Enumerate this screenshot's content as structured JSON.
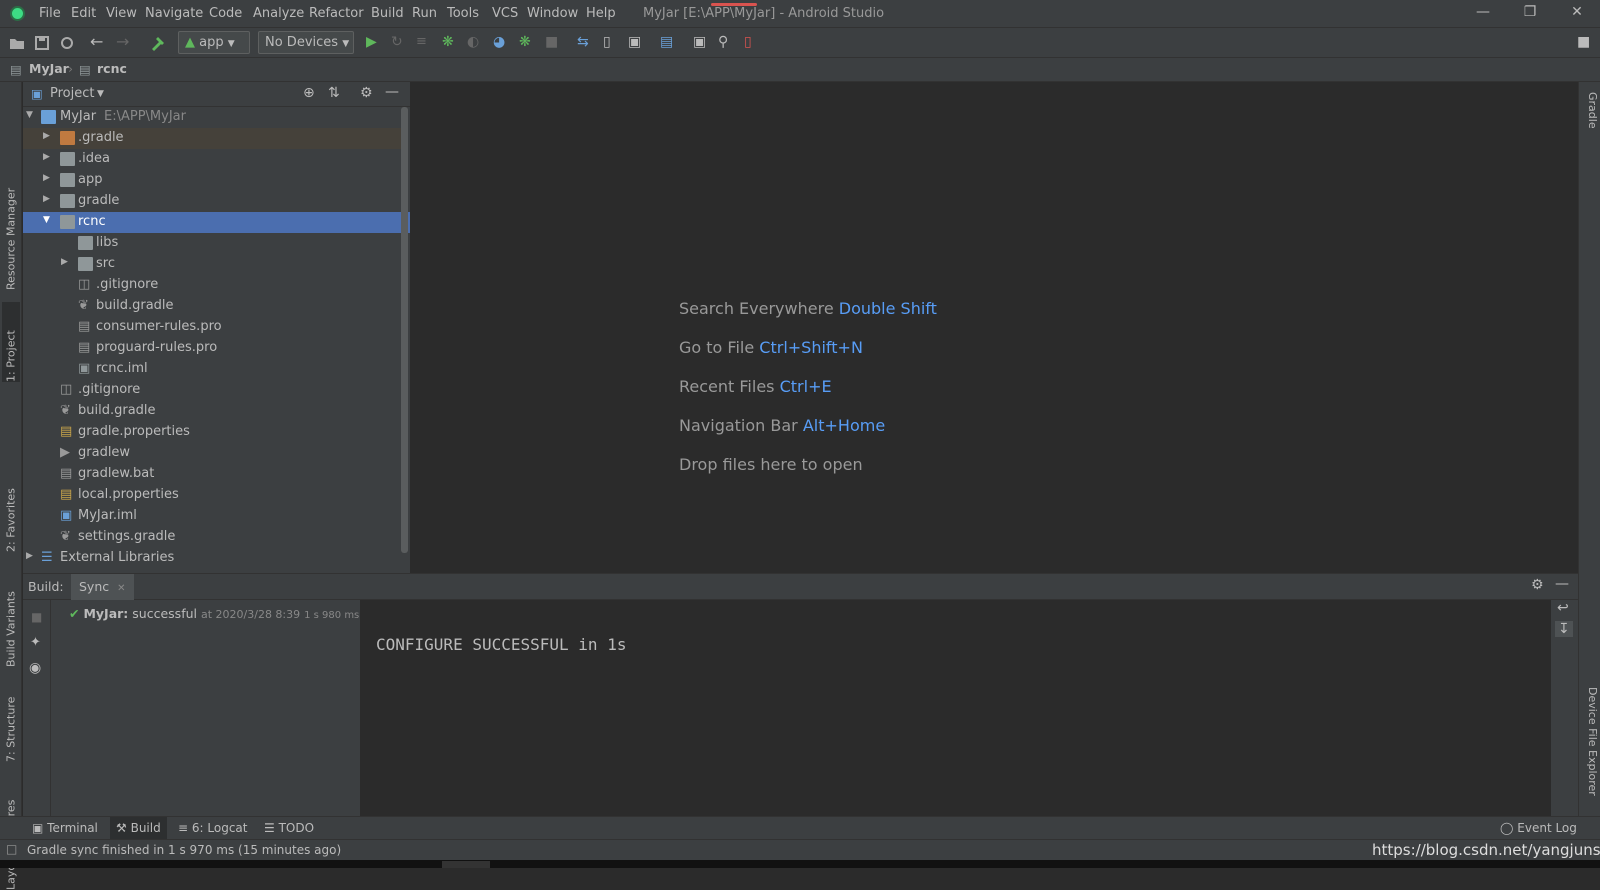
{
  "app": {
    "title": "MyJar [E:\\APP\\MyJar] - Android Studio",
    "accent": "#589df6"
  },
  "menu": [
    "File",
    "Edit",
    "View",
    "Navigate",
    "Code",
    "Analyze",
    "Refactor",
    "Build",
    "Run",
    "Tools",
    "VCS",
    "Window",
    "Help"
  ],
  "toolbar": {
    "run_config": "app",
    "device": "No Devices"
  },
  "breadcrumb": {
    "project": "MyJar",
    "module": "rcnc"
  },
  "left_tabs": {
    "resource_manager": "Resource Manager",
    "project": "1: Project",
    "favorites": "2: Favorites",
    "build_variants": "Build Variants",
    "structure": "7: Structure",
    "layout_captures": "Layout Captures"
  },
  "right_tabs": {
    "gradle": "Gradle",
    "device_file_explorer": "Device File Explorer"
  },
  "project_panel": {
    "view_label": "Project",
    "root": {
      "name": "MyJar",
      "path": "E:\\APP\\MyJar"
    },
    "items": [
      {
        "label": ".gradle"
      },
      {
        "label": ".idea"
      },
      {
        "label": "app"
      },
      {
        "label": "gradle"
      },
      {
        "label": "rcnc"
      },
      {
        "label": "libs"
      },
      {
        "label": "src"
      },
      {
        "label": ".gitignore"
      },
      {
        "label": "build.gradle"
      },
      {
        "label": "consumer-rules.pro"
      },
      {
        "label": "proguard-rules.pro"
      },
      {
        "label": "rcnc.iml"
      },
      {
        "label": ".gitignore"
      },
      {
        "label": "build.gradle"
      },
      {
        "label": "gradle.properties"
      },
      {
        "label": "gradlew"
      },
      {
        "label": "gradlew.bat"
      },
      {
        "label": "local.properties"
      },
      {
        "label": "MyJar.iml"
      },
      {
        "label": "settings.gradle"
      },
      {
        "label": "External Libraries"
      }
    ]
  },
  "editor_hints": [
    {
      "text": "Search Everywhere",
      "key": "Double Shift"
    },
    {
      "text": "Go to File",
      "key": "Ctrl+Shift+N"
    },
    {
      "text": "Recent Files",
      "key": "Ctrl+E"
    },
    {
      "text": "Navigation Bar",
      "key": "Alt+Home"
    },
    {
      "text": "Drop files here to open",
      "key": ""
    }
  ],
  "build_panel": {
    "title": "Build:",
    "tab": "Sync",
    "result_name": "MyJar:",
    "result_status": "successful",
    "result_time": "at 2020/3/28 8:39",
    "result_duration": "1 s 980 ms",
    "console_text": "CONFIGURE SUCCESSFUL in 1s"
  },
  "bottom_tabs": {
    "terminal": "Terminal",
    "build": "Build",
    "logcat": "6: Logcat",
    "todo": "TODO",
    "event_log": "Event Log"
  },
  "status": {
    "message": "Gradle sync finished in 1 s 970 ms (15 minutes ago)",
    "watermark": "https://blog.csdn.net/yangjunsc"
  }
}
